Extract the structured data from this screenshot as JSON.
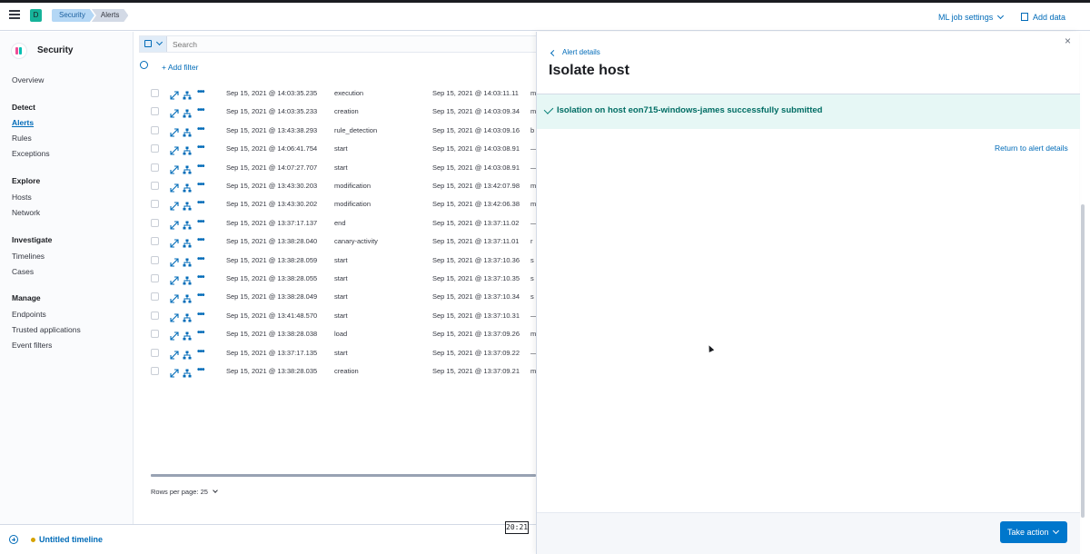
{
  "header": {
    "space_initial": "D",
    "breadcrumbs": [
      "Security",
      "Alerts"
    ],
    "ml_job_settings": "ML job settings",
    "add_data": "Add data"
  },
  "sidebar": {
    "title": "Security",
    "overview": "Overview",
    "sections": [
      {
        "title": "Detect",
        "items": [
          "Alerts",
          "Rules",
          "Exceptions"
        ]
      },
      {
        "title": "Explore",
        "items": [
          "Hosts",
          "Network"
        ]
      },
      {
        "title": "Investigate",
        "items": [
          "Timelines",
          "Cases"
        ]
      },
      {
        "title": "Manage",
        "items": [
          "Endpoints",
          "Trusted applications",
          "Event filters"
        ]
      }
    ],
    "active_item": "Alerts"
  },
  "search": {
    "placeholder": "Search",
    "add_filter": "+ Add filter"
  },
  "table": {
    "rows": [
      [
        "Sep 15, 2021 @ 14:03:35.235",
        "execution",
        "Sep 15, 2021 @ 14:03:11.11",
        "m"
      ],
      [
        "Sep 15, 2021 @ 14:03:35.233",
        "creation",
        "Sep 15, 2021 @ 14:03:09.34",
        "m"
      ],
      [
        "Sep 15, 2021 @ 13:43:38.293",
        "rule_detection",
        "Sep 15, 2021 @ 14:03:09.16",
        "b"
      ],
      [
        "Sep 15, 2021 @ 14:06:41.754",
        "start",
        "Sep 15, 2021 @ 14:03:08.91",
        "—"
      ],
      [
        "Sep 15, 2021 @ 14:07:27.707",
        "start",
        "Sep 15, 2021 @ 14:03:08.91",
        "—"
      ],
      [
        "Sep 15, 2021 @ 13:43:30.203",
        "modification",
        "Sep 15, 2021 @ 13:42:07.98",
        "m"
      ],
      [
        "Sep 15, 2021 @ 13:43:30.202",
        "modification",
        "Sep 15, 2021 @ 13:42:06.38",
        "m"
      ],
      [
        "Sep 15, 2021 @ 13:37:17.137",
        "end",
        "Sep 15, 2021 @ 13:37:11.02",
        "—"
      ],
      [
        "Sep 15, 2021 @ 13:38:28.040",
        "canary-activity",
        "Sep 15, 2021 @ 13:37:11.01",
        "r"
      ],
      [
        "Sep 15, 2021 @ 13:38:28.059",
        "start",
        "Sep 15, 2021 @ 13:37:10.36",
        "s"
      ],
      [
        "Sep 15, 2021 @ 13:38:28.055",
        "start",
        "Sep 15, 2021 @ 13:37:10.35",
        "s"
      ],
      [
        "Sep 15, 2021 @ 13:38:28.049",
        "start",
        "Sep 15, 2021 @ 13:37:10.34",
        "s"
      ],
      [
        "Sep 15, 2021 @ 13:41:48.570",
        "start",
        "Sep 15, 2021 @ 13:37:10.31",
        "—"
      ],
      [
        "Sep 15, 2021 @ 13:38:28.038",
        "load",
        "Sep 15, 2021 @ 13:37:09.26",
        "m"
      ],
      [
        "Sep 15, 2021 @ 13:37:17.135",
        "start",
        "Sep 15, 2021 @ 13:37:09.22",
        "—"
      ],
      [
        "Sep 15, 2021 @ 13:38:28.035",
        "creation",
        "Sep 15, 2021 @ 13:37:09.21",
        "m"
      ]
    ],
    "rows_per_page": "Rows per page: 25"
  },
  "bottom": {
    "timeline": "Untitled timeline",
    "clock": "20:21"
  },
  "flyout": {
    "back_link": "Alert details",
    "title": "Isolate host",
    "callout": "Isolation on host eon715-windows-james successfully submitted",
    "return_link": "Return to alert details",
    "take_action": "Take action",
    "close_glyph": "×"
  },
  "colors": {
    "accent": "#006bb8",
    "success_bg": "#e6f7f5",
    "success_text": "#006d64",
    "primary_button": "#0077cc"
  }
}
